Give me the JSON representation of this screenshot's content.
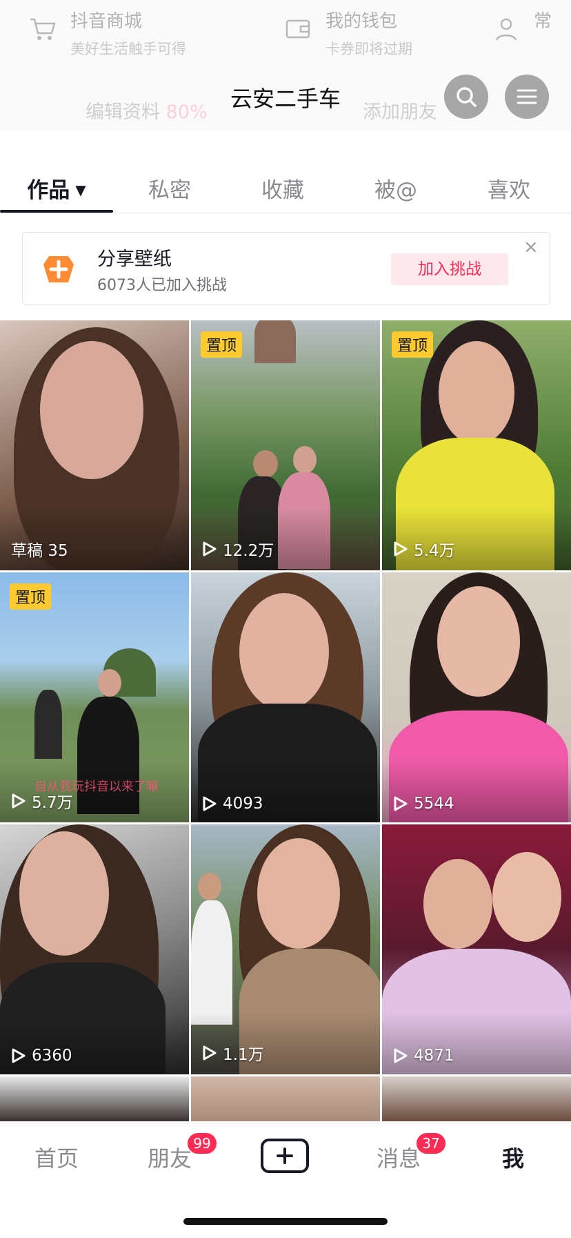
{
  "shortcuts": [
    {
      "title": "抖音商城",
      "subtitle": "美好生活触手可得",
      "icon": "cart-icon"
    },
    {
      "title": "我的钱包",
      "subtitle": "卡券即将过期",
      "icon": "wallet-icon"
    },
    {
      "title": "常",
      "subtitle": "",
      "icon": "person-icon"
    }
  ],
  "profile_actions": {
    "edit": "编辑资料",
    "edit_percent": "80%",
    "add_friends": "添加朋友"
  },
  "header": {
    "title": "云安二手车",
    "search_icon": "search-icon",
    "menu_icon": "menu-icon"
  },
  "tabs": [
    {
      "label": "作品",
      "active": true
    },
    {
      "label": "私密"
    },
    {
      "label": "收藏"
    },
    {
      "label": "被@"
    },
    {
      "label": "喜欢"
    }
  ],
  "challenge": {
    "title": "分享壁纸",
    "subtitle": "6073人已加入挑战",
    "button": "加入挑战",
    "close": "×"
  },
  "videos": [
    {
      "label": "草稿 35",
      "pinned": false,
      "draft": true
    },
    {
      "label": "12.2万",
      "pinned": true
    },
    {
      "label": "5.4万",
      "pinned": true
    },
    {
      "label": "5.7万",
      "pinned": true,
      "caption": "自从我玩抖音以来了嘛"
    },
    {
      "label": "4093",
      "pinned": false
    },
    {
      "label": "5544",
      "pinned": false
    },
    {
      "label": "6360",
      "pinned": false
    },
    {
      "label": "1.1万",
      "pinned": false
    },
    {
      "label": "4871",
      "pinned": false
    }
  ],
  "pin_label": "置顶",
  "nav": {
    "home": "首页",
    "friends": "朋友",
    "friends_count": "99",
    "messages": "消息",
    "messages_count": "37",
    "me": "我"
  },
  "colors": {
    "accent": "#fe2c55",
    "pin": "#fdcb2f"
  }
}
